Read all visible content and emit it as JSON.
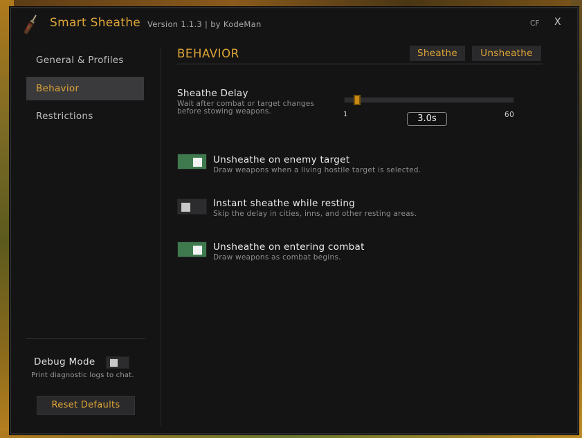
{
  "app": {
    "title": "Smart Sheathe",
    "version": "Version 1.1.3  |  by KodeMan",
    "cf_label": "CF",
    "close_label": "X"
  },
  "sidebar": {
    "items": [
      {
        "label": "General & Profiles",
        "active": false
      },
      {
        "label": "Behavior",
        "active": true
      },
      {
        "label": "Restrictions",
        "active": false
      }
    ],
    "debug": {
      "label": "Debug Mode",
      "description": "Print diagnostic logs to chat.",
      "enabled": false
    },
    "reset_label": "Reset Defaults"
  },
  "main": {
    "section_title": "BEHAVIOR",
    "sheathe_button": "Sheathe",
    "unsheathe_button": "Unsheathe",
    "delay": {
      "label": "Sheathe Delay",
      "description": "Wait after combat or target changes before stowing weapons.",
      "min_label": "1",
      "max_label": "60",
      "min": 1,
      "max": 60,
      "value": 3.0,
      "value_label": "3.0s"
    },
    "options": [
      {
        "title": "Unsheathe on enemy target",
        "description": "Draw weapons when a living hostile target is selected.",
        "enabled": true
      },
      {
        "title": "Instant sheathe while resting",
        "description": "Skip the delay in cities, inns, and other resting areas.",
        "enabled": false
      },
      {
        "title": "Unsheathe on entering combat",
        "description": "Draw weapons as combat begins.",
        "enabled": true
      }
    ]
  },
  "colors": {
    "accent": "#e0a636",
    "toggle_on": "#3e7a4e",
    "slider_thumb": "#c88a14"
  }
}
